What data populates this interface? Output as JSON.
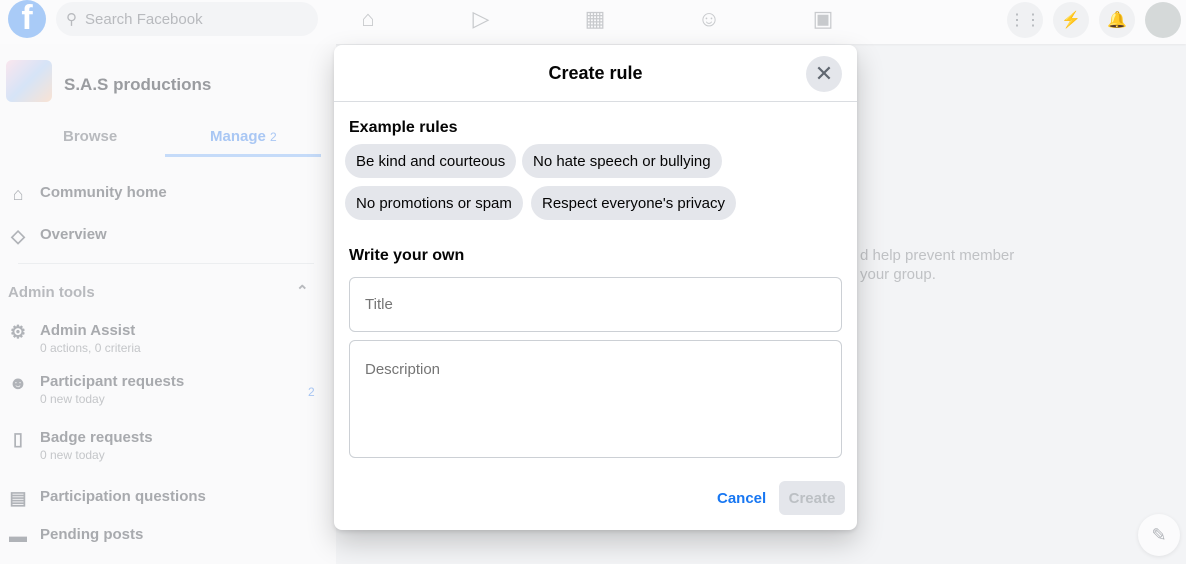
{
  "topbar": {
    "search_placeholder": "Search Facebook",
    "logo": "f"
  },
  "sidebar": {
    "group_name": "S.A.S productions",
    "tabs": [
      {
        "label": "Browse"
      },
      {
        "label": "Manage",
        "badge": "2"
      }
    ],
    "items": [
      {
        "label": "Community home",
        "icon": "home-icon"
      },
      {
        "label": "Overview",
        "icon": "layers-icon"
      }
    ],
    "admin_tools_label": "Admin tools",
    "admin_items": [
      {
        "label": "Admin Assist",
        "sub": "0 actions, 0 criteria"
      },
      {
        "label": "Participant requests",
        "sub": "0 new today",
        "badge": "2"
      },
      {
        "label": "Badge requests",
        "sub": "0 new today"
      },
      {
        "label": "Participation questions"
      },
      {
        "label": "Pending posts"
      }
    ]
  },
  "background_text": {
    "line1": "d help prevent member",
    "line2": "your group."
  },
  "modal": {
    "title": "Create rule",
    "example_label": "Example rules",
    "examples": [
      "Be kind and courteous",
      "No hate speech or bullying",
      "No promotions or spam",
      "Respect everyone's privacy"
    ],
    "write_label": "Write your own",
    "title_placeholder": "Title",
    "description_placeholder": "Description",
    "cancel": "Cancel",
    "create": "Create"
  },
  "colors": {
    "accent": "#1877f2",
    "chip": "#e4e6eb"
  }
}
